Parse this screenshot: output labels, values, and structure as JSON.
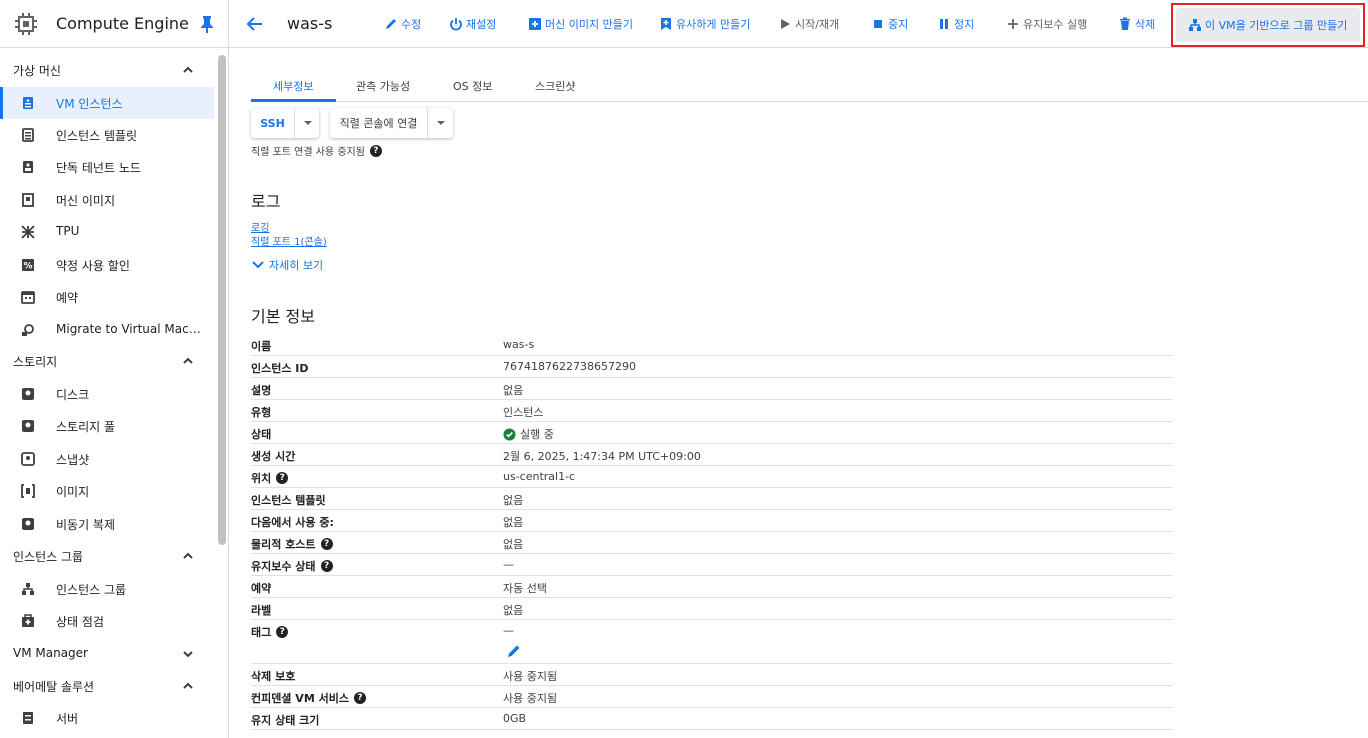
{
  "app": {
    "title": "Compute Engine"
  },
  "sidebar": {
    "sections": [
      {
        "label": "가상 머신",
        "expanded": true
      },
      {
        "label": "스토리지",
        "expanded": true
      },
      {
        "label": "인스턴스 그룹",
        "expanded": true
      },
      {
        "label": "VM Manager",
        "expanded": false
      },
      {
        "label": "베어메탈 솔루션",
        "expanded": true
      }
    ],
    "items": [
      {
        "label": "VM 인스턴스",
        "icon": "vm-instance-icon",
        "active": true
      },
      {
        "label": "인스턴스 템플릿",
        "icon": "template-icon"
      },
      {
        "label": "단독 테넌트 노드",
        "icon": "tenant-node-icon"
      },
      {
        "label": "머신 이미지",
        "icon": "machine-image-icon"
      },
      {
        "label": "TPU",
        "icon": "tpu-icon"
      },
      {
        "label": "약정 사용 할인",
        "icon": "percent-icon"
      },
      {
        "label": "예약",
        "icon": "calendar-icon"
      },
      {
        "label": "Migrate to Virtual Machines",
        "icon": "migrate-icon"
      },
      {
        "label": "디스크",
        "icon": "disk-icon"
      },
      {
        "label": "스토리지 풀",
        "icon": "storage-pool-icon"
      },
      {
        "label": "스냅샷",
        "icon": "snapshot-icon"
      },
      {
        "label": "이미지",
        "icon": "image-icon"
      },
      {
        "label": "비동기 복제",
        "icon": "replication-icon"
      },
      {
        "label": "인스턴스 그룹",
        "icon": "instance-group-icon"
      },
      {
        "label": "상태 점검",
        "icon": "health-check-icon"
      },
      {
        "label": "서버",
        "icon": "server-icon"
      }
    ]
  },
  "toolbar": {
    "vm_name": "was-s",
    "edit": "수정",
    "reset": "재설정",
    "create_machine_image": "머신 이미지 만들기",
    "create_similar": "유사하게 만들기",
    "start_resume": "시작/재개",
    "stop": "중지",
    "suspend": "정지",
    "run_maintenance": "유지보수 실행",
    "delete": "삭제",
    "create_group": "이 VM을 기반으로 그룹 만들기"
  },
  "tabs": [
    "세부정보",
    "관측 가능성",
    "OS 정보",
    "스크린샷"
  ],
  "connect": {
    "ssh": "SSH",
    "serial_console": "직렬 콘솔에 연결",
    "serial_note": "직렬 포트 연결 사용 중지됨"
  },
  "logs": {
    "title": "로그",
    "links": [
      "로깅",
      "직렬 포트 1(콘솔)"
    ],
    "more": "자세히 보기"
  },
  "basic_info": {
    "title": "기본 정보",
    "rows": [
      {
        "key": "이름",
        "value": "was-s"
      },
      {
        "key": "인스턴스 ID",
        "value": "7674187622738657290"
      },
      {
        "key": "설명",
        "value": "없음"
      },
      {
        "key": "유형",
        "value": "인스턴스"
      },
      {
        "key": "상태",
        "value": "실행 중",
        "status": "running"
      },
      {
        "key": "생성 시간",
        "value": "2월 6, 2025, 1:47:34 PM UTC+09:00"
      },
      {
        "key": "위치",
        "value": "us-central1-c",
        "help": true
      },
      {
        "key": "인스턴스 템플릿",
        "value": "없음"
      },
      {
        "key": "다음에서 사용 중:",
        "value": "없음"
      },
      {
        "key": "물리적 호스트",
        "value": "없음",
        "help": true
      },
      {
        "key": "유지보수 상태",
        "value": "—",
        "help": true
      },
      {
        "key": "예약",
        "value": "자동 선택"
      },
      {
        "key": "라벨",
        "value": "없음"
      },
      {
        "key": "태그",
        "value": "—",
        "help": true,
        "editable": true
      },
      {
        "key": "삭제 보호",
        "value": "사용 중지됨"
      },
      {
        "key": "컨피덴셜 VM 서비스",
        "value": "사용 중지됨",
        "help": true
      },
      {
        "key": "유지 상태 크기",
        "value": "0GB"
      }
    ]
  },
  "colors": {
    "accent": "#1a73e8",
    "active_bg": "#e8f0fe",
    "highlight": "#e02424",
    "success": "#188038"
  }
}
